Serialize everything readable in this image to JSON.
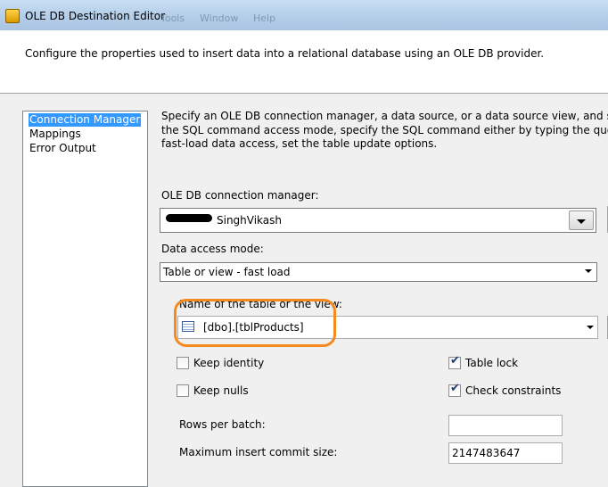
{
  "window": {
    "title": "OLE DB Destination Editor",
    "menu_ghost": [
      "Tools",
      "Window",
      "Help"
    ]
  },
  "header": {
    "description": "Configure the properties used to insert data into a relational database using an OLE DB provider."
  },
  "nav": {
    "items": [
      {
        "label": "Connection Manager",
        "selected": true
      },
      {
        "label": "Mappings",
        "selected": false
      },
      {
        "label": "Error Output",
        "selected": false
      }
    ]
  },
  "content": {
    "intro_lines": [
      "Specify an OLE DB connection manager, a data source, or a data source view, and select the dat",
      "the SQL command access mode, specify the SQL command either by typing the query or by usi",
      "fast-load data access, set the table update options."
    ],
    "connection_manager_label": "OLE DB connection manager:",
    "connection_manager_value": "SinghVikash",
    "data_access_mode_label": "Data access mode:",
    "data_access_mode_value": "Table or view - fast load",
    "table_label": "Name of the table or the view:",
    "table_value": "[dbo].[tblProducts]",
    "checkboxes": {
      "keep_identity": {
        "label": "Keep identity",
        "checked": false
      },
      "keep_nulls": {
        "label": "Keep nulls",
        "checked": false
      },
      "table_lock": {
        "label": "Table lock",
        "checked": true
      },
      "check_constraints": {
        "label": "Check constraints",
        "checked": true
      }
    },
    "rows_per_batch_label": "Rows per batch:",
    "rows_per_batch_value": "",
    "max_commit_label": "Maximum insert commit size:",
    "max_commit_value": "2147483647"
  },
  "colors": {
    "selection": "#3399ff",
    "highlight_outline": "#f58b1f"
  }
}
